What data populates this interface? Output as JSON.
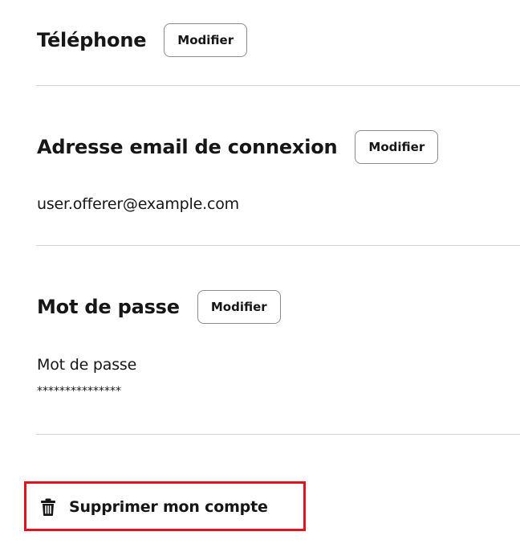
{
  "phone": {
    "title": "Téléphone",
    "modify_label": "Modifier"
  },
  "email": {
    "title": "Adresse email de connexion",
    "modify_label": "Modifier",
    "value": "user.offerer@example.com"
  },
  "password": {
    "title": "Mot de passe",
    "modify_label": "Modifier",
    "field_label": "Mot de passe",
    "masked_value": "***************"
  },
  "delete_account": {
    "label": "Supprimer mon compte",
    "icon": "trash-icon",
    "highlight_color": "#e0141f"
  }
}
